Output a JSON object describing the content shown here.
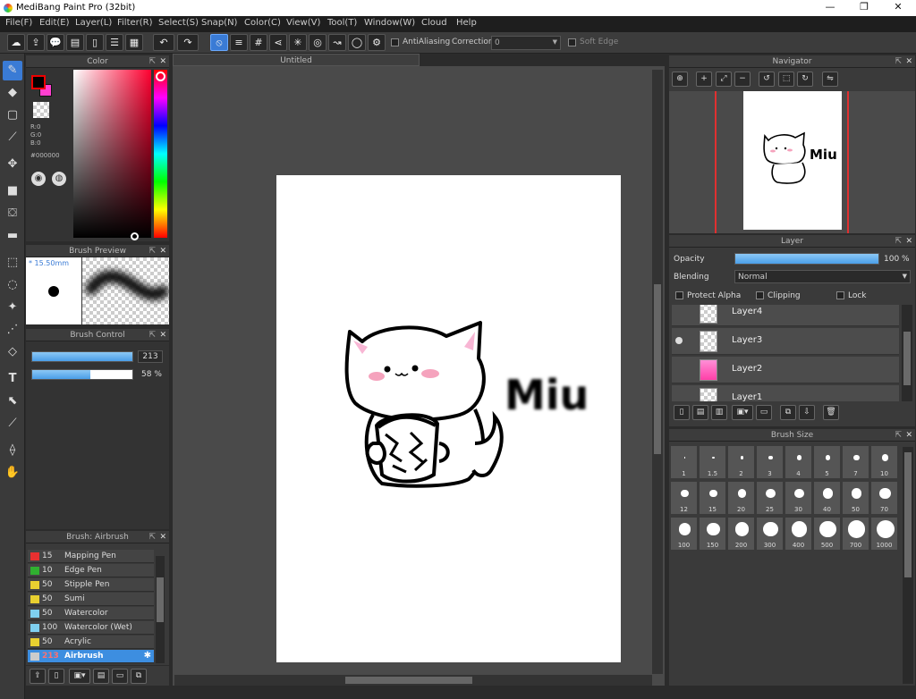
{
  "window": {
    "title": "MediBang Paint Pro (32bit)",
    "minimize": "—",
    "maximize": "❐",
    "close": "✕"
  },
  "menu": [
    "File(F)",
    "Edit(E)",
    "Layer(L)",
    "Filter(R)",
    "Select(S)",
    "Snap(N)",
    "Color(C)",
    "View(V)",
    "Tool(T)",
    "Window(W)",
    "Cloud",
    "Help"
  ],
  "toolbar": {
    "antialiasing_label": "AntiAliasing",
    "correction_label": "Correction",
    "correction_value": "0",
    "soft_edge_label": "Soft Edge"
  },
  "color_panel": {
    "title": "Color",
    "r": "R:0",
    "g": "G:0",
    "b": "B:0",
    "hex": "#000000",
    "primary": "#000000",
    "secondary": "#ff3fcf"
  },
  "brush_preview": {
    "title": "Brush Preview",
    "size_label": "* 15.50mm"
  },
  "brush_control": {
    "title": "Brush Control",
    "size_value": "213",
    "opacity_value": "58 %",
    "size_fraction": 1.0,
    "opacity_fraction": 0.58
  },
  "brush_list": {
    "title": "Brush: Airbrush",
    "items": [
      {
        "size": "15",
        "name": "Mapping Pen",
        "color": "#e83030"
      },
      {
        "size": "10",
        "name": "Edge Pen",
        "color": "#30b030"
      },
      {
        "size": "50",
        "name": "Stipple Pen",
        "color": "#e8d030"
      },
      {
        "size": "50",
        "name": "Sumi",
        "color": "#e8d030"
      },
      {
        "size": "50",
        "name": "Watercolor",
        "color": "#7fd0f0"
      },
      {
        "size": "100",
        "name": "Watercolor (Wet)",
        "color": "#7fd0f0"
      },
      {
        "size": "50",
        "name": "Acrylic",
        "color": "#e8d030"
      },
      {
        "size": "213",
        "name": "Airbrush",
        "color": "#cccccc"
      }
    ]
  },
  "document": {
    "tab_title": "Untitled",
    "drawing_text": "Miu"
  },
  "navigator": {
    "title": "Navigator"
  },
  "layer_panel": {
    "title": "Layer",
    "opacity_label": "Opacity",
    "opacity_value": "100 %",
    "opacity_fraction": 1.0,
    "blending_label": "Blending",
    "blending_value": "Normal",
    "protect_alpha_label": "Protect Alpha",
    "clipping_label": "Clipping",
    "lock_label": "Lock",
    "layers": [
      {
        "name": "Layer4",
        "thumb": "checker"
      },
      {
        "name": "Layer3",
        "thumb": "checker"
      },
      {
        "name": "Layer2",
        "thumb": "pink"
      },
      {
        "name": "Layer1",
        "thumb": "checker"
      }
    ]
  },
  "brush_size_panel": {
    "title": "Brush Size",
    "sizes": [
      "1",
      "1.5",
      "2",
      "3",
      "4",
      "5",
      "7",
      "10",
      "12",
      "15",
      "20",
      "25",
      "30",
      "40",
      "50",
      "70",
      "100",
      "150",
      "200",
      "300",
      "400",
      "500",
      "700",
      "1000"
    ]
  },
  "colors": {
    "accent": "#3a7bd5",
    "panel": "#333333",
    "canvas_bg": "#4a4a4a"
  }
}
